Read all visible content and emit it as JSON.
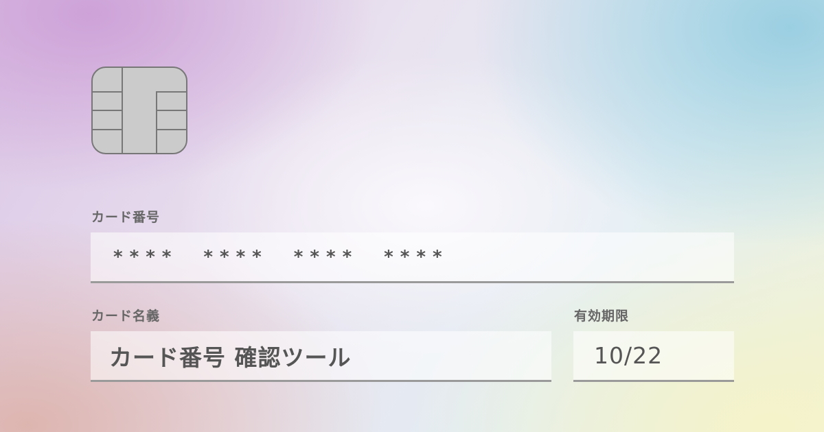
{
  "card": {
    "chip_icon": "sim-chip-icon",
    "number": {
      "label": "カード番号",
      "groups": [
        "****",
        "****",
        "****",
        "****"
      ]
    },
    "holder": {
      "label": "カード名義",
      "value": "カード番号 確認ツール"
    },
    "expiry": {
      "label": "有効期限",
      "value": "10/22"
    }
  },
  "colors": {
    "chip_fill": "#cbcbcb",
    "chip_stroke": "#777777",
    "label_text": "#666666",
    "field_text": "#555555",
    "field_underline": "#9a9a9a"
  }
}
